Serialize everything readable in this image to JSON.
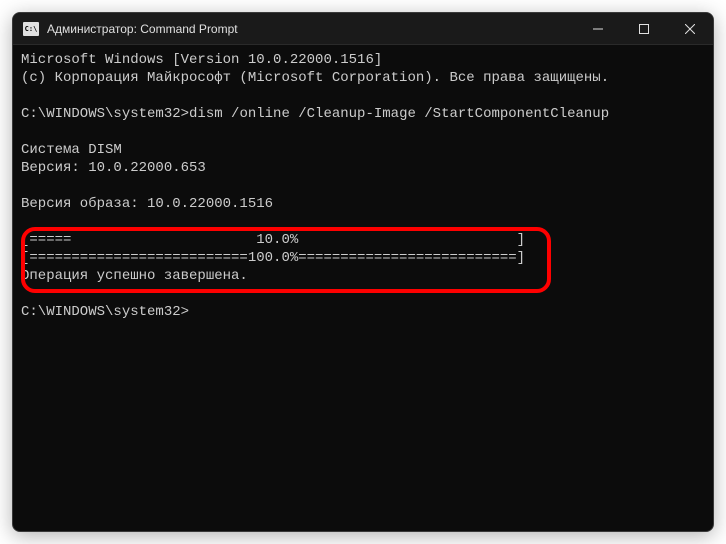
{
  "titlebar": {
    "icon_label": "C:\\",
    "title": "Администратор: Command Prompt"
  },
  "console": {
    "line1": "Microsoft Windows [Version 10.0.22000.1516]",
    "line2": "(c) Корпорация Майкрософт (Microsoft Corporation). Все права защищены.",
    "prompt1_path": "C:\\WINDOWS\\system32>",
    "prompt1_cmd": "dism /online /Cleanup-Image /StartComponentCleanup",
    "blank": "",
    "sys_line": "Cистема DISM",
    "ver_line": "Версия: 10.0.22000.653",
    "img_ver_line": "Версия образа: 10.0.22000.1516",
    "progress1": "[=====                      10.0%                          ]",
    "progress2": "[==========================100.0%==========================]",
    "success": "Операция успешно завершена.",
    "prompt2_path": "C:\\WINDOWS\\system32>"
  }
}
